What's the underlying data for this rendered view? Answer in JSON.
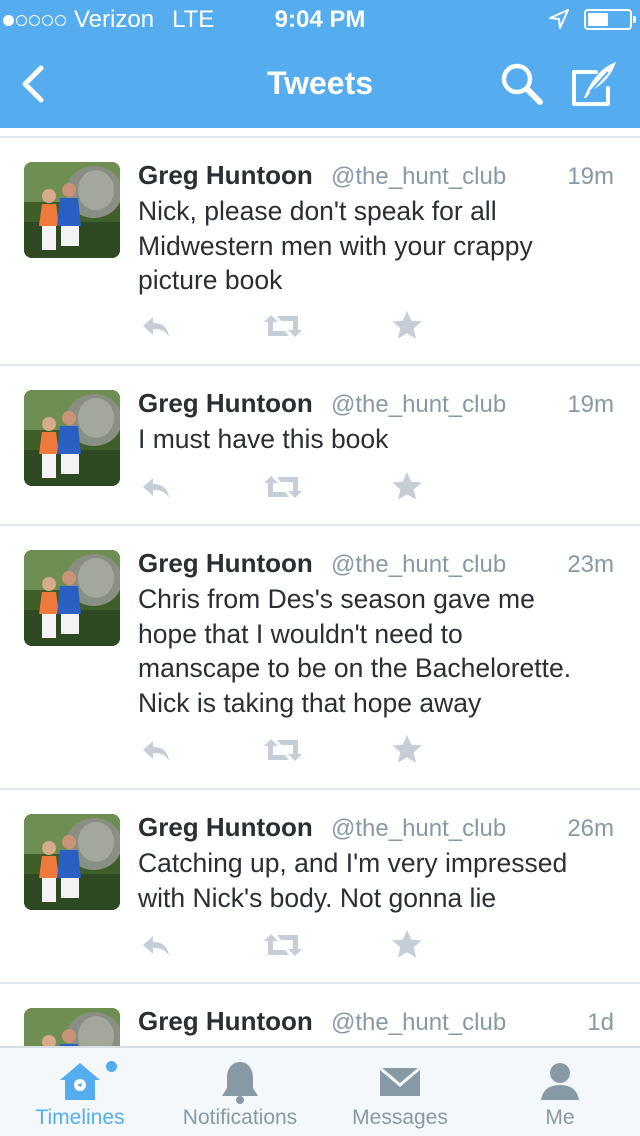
{
  "status_bar": {
    "carrier": "Verizon",
    "network": "LTE",
    "time": "9:04 PM",
    "signal_bars_filled": 1,
    "signal_bars_total": 5
  },
  "nav": {
    "title": "Tweets"
  },
  "tweets": [
    {
      "name": "Greg Huntoon",
      "handle": "@the_hunt_club",
      "time": "19m",
      "text": "Nick, please don't speak for all\nMidwestern men with your crappy\npicture book"
    },
    {
      "name": "Greg Huntoon",
      "handle": "@the_hunt_club",
      "time": "19m",
      "text": "I must have this book"
    },
    {
      "name": "Greg Huntoon",
      "handle": "@the_hunt_club",
      "time": "23m",
      "text": "Chris from Des's season gave me\nhope that I wouldn't need to\nmanscape to be on the Bachelorette.\nNick is taking that hope away"
    },
    {
      "name": "Greg Huntoon",
      "handle": "@the_hunt_club",
      "time": "26m",
      "text": "Catching up, and I'm very impressed\nwith Nick's body. Not gonna lie"
    },
    {
      "name": "Greg Huntoon",
      "handle": "@the_hunt_club",
      "time": "1d",
      "text": ""
    }
  ],
  "tabbar": {
    "timelines": "Timelines",
    "notifications": "Notifications",
    "messages": "Messages",
    "me": "Me"
  },
  "colors": {
    "brand": "#55acee",
    "text": "#292f33",
    "muted": "#8899a6",
    "action": "#c5ced6"
  }
}
